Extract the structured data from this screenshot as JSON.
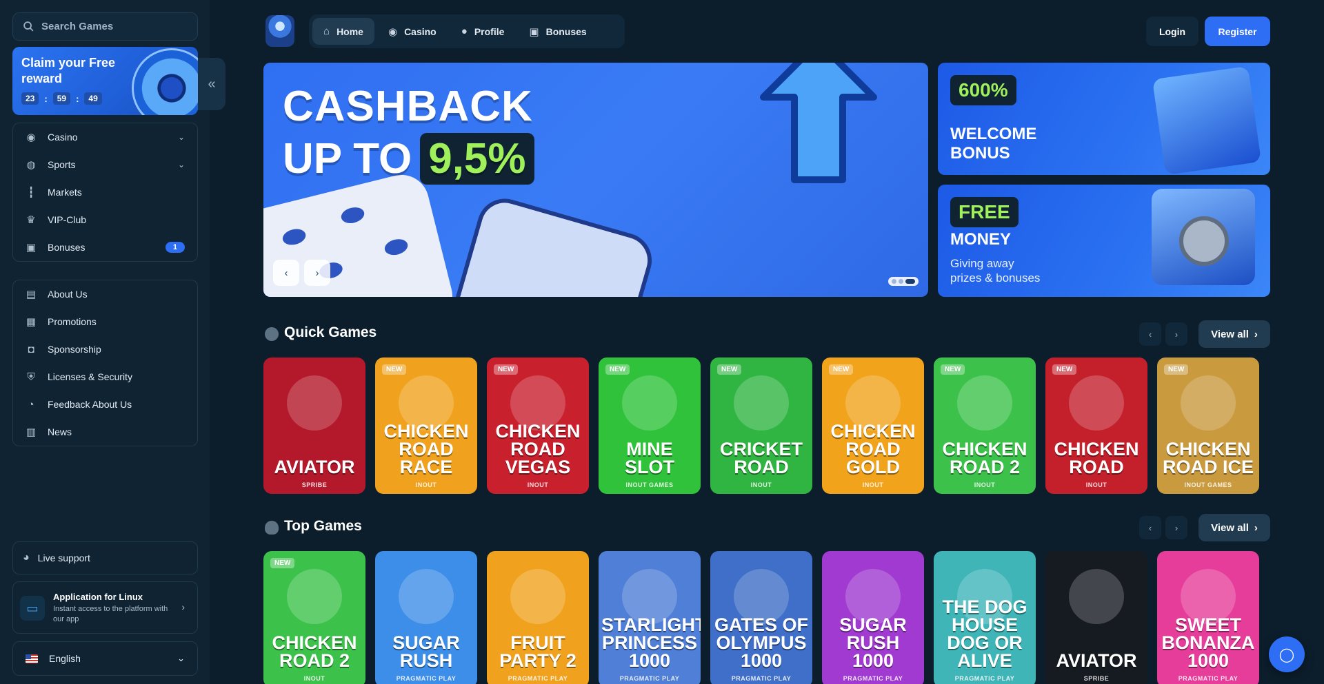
{
  "search": {
    "placeholder": "Search Games"
  },
  "reward": {
    "title": "Claim your Free reward",
    "timer": [
      "23",
      "59",
      "49"
    ]
  },
  "sidebar": {
    "main_items": [
      {
        "label": "Casino",
        "icon": "casino-chip-icon",
        "dropdown": true
      },
      {
        "label": "Sports",
        "icon": "ball-icon",
        "dropdown": true
      },
      {
        "label": "Markets",
        "icon": "candlestick-icon"
      },
      {
        "label": "VIP-Club",
        "icon": "crown-icon"
      },
      {
        "label": "Bonuses",
        "icon": "gift-icon",
        "badge": "1"
      }
    ],
    "info_items": [
      {
        "label": "About Us",
        "icon": "book-icon"
      },
      {
        "label": "Promotions",
        "icon": "ticket-icon"
      },
      {
        "label": "Sponsorship",
        "icon": "medal-icon"
      },
      {
        "label": "Licenses & Security",
        "icon": "shield-icon"
      },
      {
        "label": "Feedback About Us",
        "icon": "chat-icon"
      },
      {
        "label": "News",
        "icon": "news-icon"
      }
    ],
    "live_support": "Live support",
    "app": {
      "title": "Application for Linux",
      "subtitle": "Instant access to the platform with our app"
    },
    "language": "English"
  },
  "nav": {
    "items": [
      {
        "label": "Home",
        "active": true
      },
      {
        "label": "Casino"
      },
      {
        "label": "Profile"
      },
      {
        "label": "Bonuses"
      }
    ],
    "login": "Login",
    "register": "Register"
  },
  "hero": {
    "line1": "CASHBACK",
    "line2_prefix": "UP TO",
    "highlight": "9,5%"
  },
  "welcome_banner": {
    "pill": "600%",
    "title_line1": "WELCOME",
    "title_line2": "BONUS"
  },
  "free_money_banner": {
    "pill": "FREE",
    "title": "MONEY",
    "subtitle_line1": "Giving away",
    "subtitle_line2": "prizes & bonuses"
  },
  "sections": {
    "quick_games": {
      "title": "Quick Games",
      "view_all": "View all",
      "games": [
        {
          "title": "AVIATOR",
          "provider": "SPRIBE",
          "new": false,
          "color": "#b3182b"
        },
        {
          "title": "CHICKEN ROAD RACE",
          "provider": "INOUT",
          "new": true,
          "color": "#f0a21e"
        },
        {
          "title": "CHICKEN ROAD VEGAS",
          "provider": "INOUT",
          "new": true,
          "color": "#c9202e"
        },
        {
          "title": "MINE SLOT",
          "provider": "INOUT GAMES",
          "new": true,
          "color": "#2fc23a"
        },
        {
          "title": "CRICKET ROAD",
          "provider": "INOUT",
          "new": true,
          "color": "#31b542"
        },
        {
          "title": "CHICKEN ROAD GOLD",
          "provider": "INOUT",
          "new": true,
          "color": "#f2a31c"
        },
        {
          "title": "CHICKEN ROAD 2",
          "provider": "INOUT",
          "new": true,
          "color": "#3cc24a"
        },
        {
          "title": "CHICKEN ROAD",
          "provider": "INOUT",
          "new": true,
          "color": "#c4202c"
        },
        {
          "title": "CHICKEN ROAD ICE",
          "provider": "INOUT GAMES",
          "new": true,
          "color": "#c99a3e"
        }
      ]
    },
    "top_games": {
      "title": "Top Games",
      "view_all": "View all",
      "games": [
        {
          "title": "CHICKEN ROAD 2",
          "provider": "INOUT",
          "new": true,
          "color": "#3cc24a"
        },
        {
          "title": "SUGAR RUSH",
          "provider": "PRAGMATIC PLAY",
          "new": false,
          "color": "#3d8ee8"
        },
        {
          "title": "FRUIT PARTY 2",
          "provider": "PRAGMATIC PLAY",
          "new": false,
          "color": "#f0a21e"
        },
        {
          "title": "STARLIGHT PRINCESS 1000",
          "provider": "PRAGMATIC PLAY",
          "new": false,
          "color": "#4f7fd6"
        },
        {
          "title": "GATES OF OLYMPUS 1000",
          "provider": "PRAGMATIC PLAY",
          "new": false,
          "color": "#3f6fc8"
        },
        {
          "title": "SUGAR RUSH 1000",
          "provider": "PRAGMATIC PLAY",
          "new": false,
          "color": "#a03ad0"
        },
        {
          "title": "THE DOG HOUSE DOG OR ALIVE",
          "provider": "PRAGMATIC PLAY",
          "new": false,
          "color": "#3fb5b8"
        },
        {
          "title": "AVIATOR",
          "provider": "SPRIBE",
          "new": false,
          "color": "#161b22"
        },
        {
          "title": "SWEET BONANZA 1000",
          "provider": "PRAGMATIC PLAY",
          "new": false,
          "color": "#e63c9a"
        }
      ]
    }
  },
  "colors": {
    "accent": "#2d6ef5",
    "highlight_green": "#9ff05a",
    "background": "#0c1e2c"
  }
}
